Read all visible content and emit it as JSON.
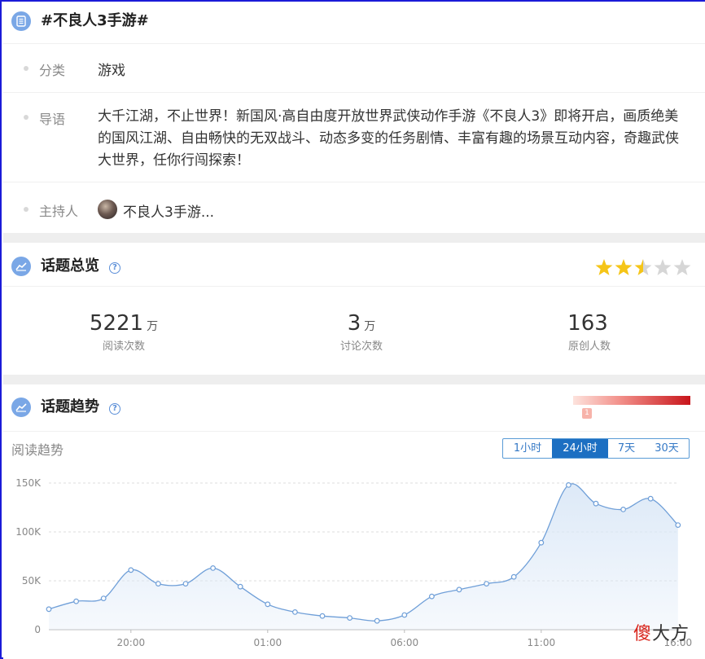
{
  "topic": {
    "title": "#不良人3手游#",
    "category_label": "分类",
    "category_value": "游戏",
    "intro_label": "导语",
    "intro_text": "大千江湖，不止世界！新国风·高自由度开放世界武侠动作手游《不良人3》即将开启，画质绝美的国风江湖、自由畅快的无双战斗、动态多变的任务剧情、丰富有趣的场景互动内容，奇趣武侠大世界，任你行闯探索！",
    "host_label": "主持人",
    "host_name": "不良人3手游..."
  },
  "overview": {
    "title": "话题总览",
    "help": "?",
    "rating": 2.5,
    "rating_max": 5,
    "stats": [
      {
        "value": "5221",
        "unit": "万",
        "label": "阅读次数"
      },
      {
        "value": "3",
        "unit": "万",
        "label": "讨论次数"
      },
      {
        "value": "163",
        "unit": "",
        "label": "原创人数"
      }
    ]
  },
  "trend": {
    "title": "话题趋势",
    "help": "?",
    "heat_marker": "1",
    "subtitle": "阅读趋势",
    "tabs": [
      {
        "label": "1小时",
        "active": false
      },
      {
        "label": "24小时",
        "active": true
      },
      {
        "label": "7天",
        "active": false
      },
      {
        "label": "30天",
        "active": false
      }
    ]
  },
  "chart_data": {
    "type": "area",
    "title": "",
    "xlabel": "",
    "ylabel": "",
    "ylim": [
      0,
      150000
    ],
    "yticks": [
      {
        "value": 0,
        "label": "0"
      },
      {
        "value": 50000,
        "label": "50K"
      },
      {
        "value": 100000,
        "label": "100K"
      },
      {
        "value": 150000,
        "label": "150K"
      }
    ],
    "xticks": [
      {
        "index": 3,
        "label": "20:00"
      },
      {
        "index": 8,
        "label": "01:00"
      },
      {
        "index": 13,
        "label": "06:00"
      },
      {
        "index": 18,
        "label": "11:00"
      },
      {
        "index": 23,
        "label": "16:00"
      }
    ],
    "grid": true,
    "series": [
      {
        "values": [
          21000,
          29000,
          32000,
          61000,
          47000,
          47000,
          63000,
          44000,
          26000,
          18000,
          14000,
          12000,
          9000,
          15000,
          34000,
          41000,
          47000,
          54000,
          89000,
          148000,
          129000,
          123000,
          134000,
          107000
        ]
      }
    ],
    "colors": {
      "line": "#6f9fd8",
      "fill": "#dbe8f7",
      "grid": "#dddddd"
    }
  },
  "watermark": {
    "part1": "傻",
    "part2": "大方"
  }
}
